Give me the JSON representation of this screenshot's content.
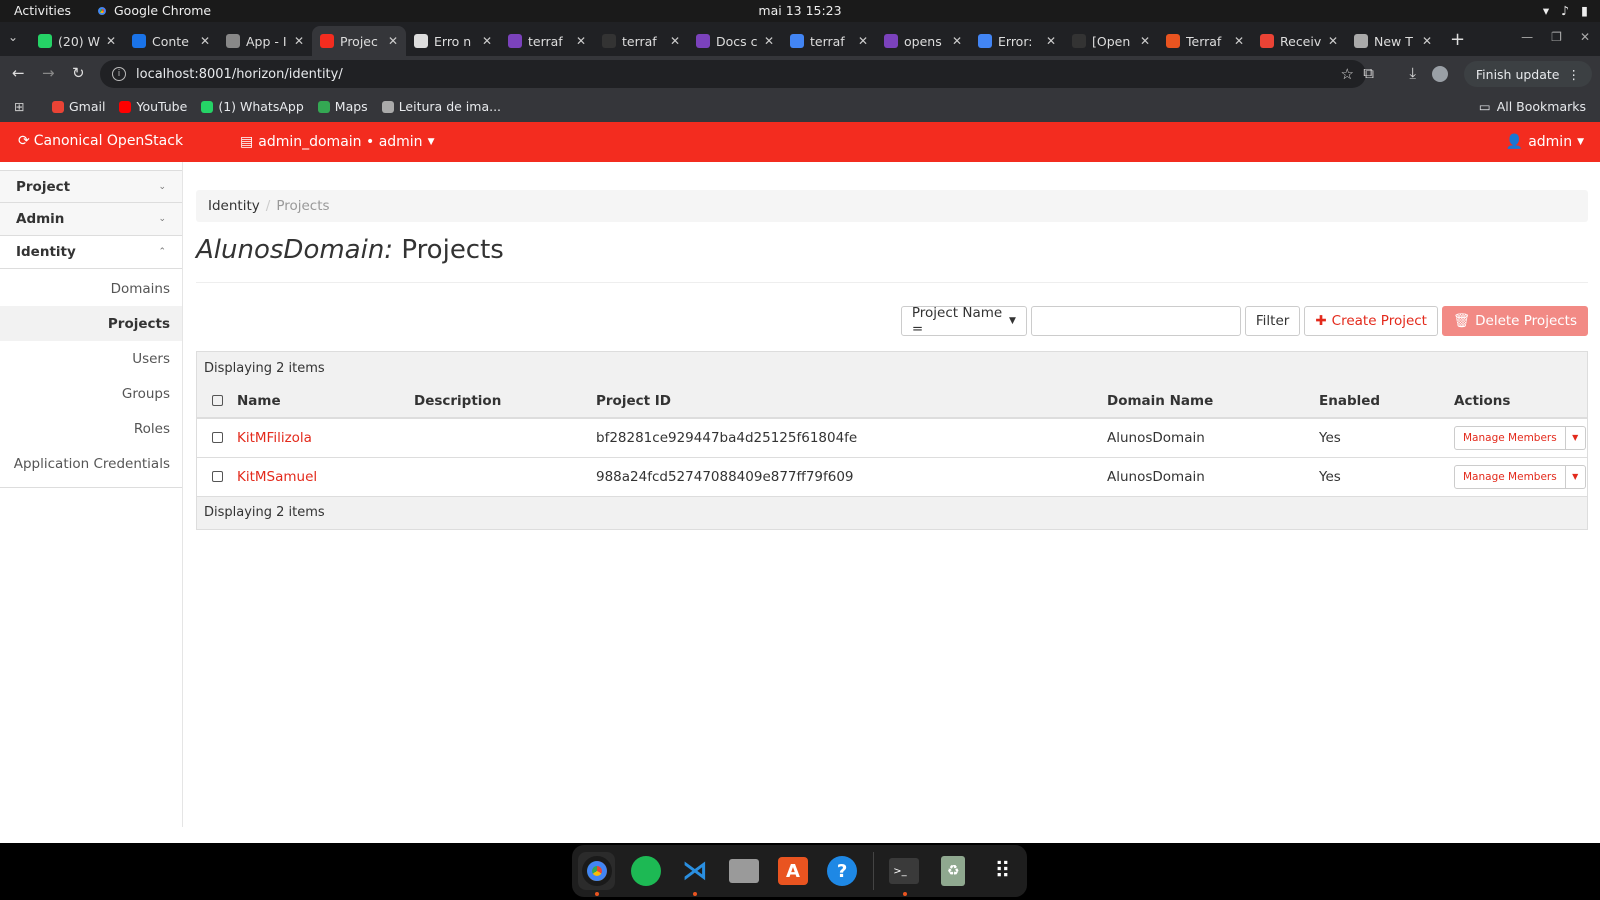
{
  "system": {
    "activities": "Activities",
    "app_name": "Google Chrome",
    "clock": "mai 13  15:23"
  },
  "browser": {
    "tabs": [
      {
        "label": "(20) W",
        "color": "#25d366"
      },
      {
        "label": "Conte",
        "color": "#1a73e8"
      },
      {
        "label": "App - I",
        "color": "#888888"
      },
      {
        "label": "Projec",
        "color": "#f32c1f",
        "active": true
      },
      {
        "label": "Erro n",
        "color": "#dddddd"
      },
      {
        "label": "terraf",
        "color": "#7b42bc"
      },
      {
        "label": "terraf",
        "color": "#333333"
      },
      {
        "label": "Docs c",
        "color": "#7b42bc"
      },
      {
        "label": "terraf",
        "color": "#4285f4"
      },
      {
        "label": "opens",
        "color": "#7b42bc"
      },
      {
        "label": "Error:",
        "color": "#4285f4"
      },
      {
        "label": "[Open",
        "color": "#333333"
      },
      {
        "label": "Terraf",
        "color": "#e95420"
      },
      {
        "label": "Receiv",
        "color": "#ea4335"
      },
      {
        "label": "New T",
        "color": "#aaaaaa"
      }
    ],
    "url": "localhost:8001/horizon/identity/",
    "finish_update": "Finish update",
    "bookmarks": [
      {
        "label": "Gmail",
        "color": "#ea4335"
      },
      {
        "label": "YouTube",
        "color": "#ff0000"
      },
      {
        "label": "(1) WhatsApp",
        "color": "#25d366"
      },
      {
        "label": "Maps",
        "color": "#34a853"
      },
      {
        "label": "Leitura de ima...",
        "color": "#aaaaaa"
      }
    ],
    "all_bookmarks": "All Bookmarks"
  },
  "header": {
    "brand": "Canonical OpenStack",
    "context": "admin_domain • admin",
    "user": "admin",
    "color": "#f32c1f"
  },
  "sidebar": {
    "panels": [
      "Project",
      "Admin",
      "Identity"
    ],
    "items": [
      "Domains",
      "Projects",
      "Users",
      "Groups",
      "Roles",
      "Application Credentials"
    ],
    "active_item": "Projects"
  },
  "breadcrumb": {
    "parent": "Identity",
    "current": "Projects"
  },
  "page": {
    "domain": "AlunosDomain:",
    "title": "Projects"
  },
  "toolbar": {
    "filter_field": "Project Name =",
    "filter_button": "Filter",
    "create_button": "Create Project",
    "delete_button": "Delete Projects"
  },
  "table": {
    "info": "Displaying 2 items",
    "columns": [
      "Name",
      "Description",
      "Project ID",
      "Domain Name",
      "Enabled",
      "Actions"
    ],
    "rows": [
      {
        "name": "KitMFilizola",
        "description": "",
        "id": "bf28281ce929447ba4d25125f61804fe",
        "domain": "AlunosDomain",
        "enabled": "Yes",
        "action": "Manage Members"
      },
      {
        "name": "KitMSamuel",
        "description": "",
        "id": "988a24fcd52747088409e877ff79f609",
        "domain": "AlunosDomain",
        "enabled": "Yes",
        "action": "Manage Members"
      }
    ]
  },
  "dock": [
    "chrome-icon",
    "spotify-icon",
    "vscode-icon",
    "files-icon",
    "app-center-icon",
    "help-icon",
    "terminal-icon",
    "trash-icon",
    "app-grid-icon"
  ]
}
